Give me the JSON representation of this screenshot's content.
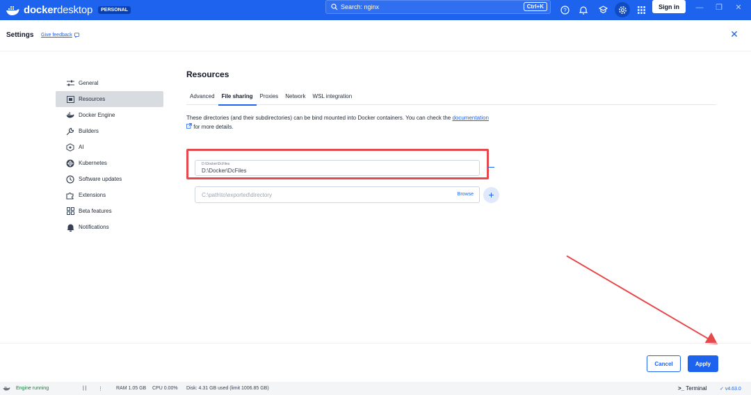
{
  "titlebar": {
    "brand_bold": "docker",
    "brand_light": "desktop",
    "plan_badge": "PERSONAL",
    "search_placeholder": "Search: nginx",
    "search_shortcut": "Ctrl+K",
    "sign_in": "Sign in",
    "icons": [
      "help-icon",
      "bell-icon",
      "learning-center-icon",
      "gear-icon",
      "grid-icon"
    ]
  },
  "header": {
    "title": "Settings",
    "feedback": "Give feedback",
    "close": "✕"
  },
  "nav": {
    "items": [
      {
        "label": "General",
        "icon": "sliders-icon"
      },
      {
        "label": "Resources",
        "icon": "resources-icon"
      },
      {
        "label": "Docker Engine",
        "icon": "whale-icon"
      },
      {
        "label": "Builders",
        "icon": "wrench-icon"
      },
      {
        "label": "AI",
        "icon": "ai-icon"
      },
      {
        "label": "Kubernetes",
        "icon": "kubernetes-icon"
      },
      {
        "label": "Software updates",
        "icon": "clock-icon"
      },
      {
        "label": "Extensions",
        "icon": "puzzle-icon"
      },
      {
        "label": "Beta features",
        "icon": "grid-icon"
      },
      {
        "label": "Notifications",
        "icon": "bell-icon"
      }
    ],
    "selected": "Resources"
  },
  "main": {
    "title": "Resources",
    "tabs": [
      "Advanced",
      "File sharing",
      "Proxies",
      "Network",
      "WSL integration"
    ],
    "active_tab": "File sharing",
    "description_before": "These directories (and their subdirectories) can be bind mounted into Docker containers. You can check the ",
    "description_link": "documentation",
    "description_after": " for more details.",
    "shared_path_label": "D:\\Docker\\DcFiles",
    "shared_path_value": "D:\\Docker\\DcFiles",
    "new_path_placeholder": "C:\\path\\to\\exported\\directory",
    "browse": "Browse"
  },
  "footer": {
    "cancel": "Cancel",
    "apply": "Apply"
  },
  "statusbar": {
    "engine": "Engine running",
    "ram": "RAM 1.05 GB",
    "cpu": "CPU 0.00%",
    "disk": "Disk: 4.31 GB used (limit 1006.85 GB)",
    "terminal": "Terminal",
    "version": "v4.63.0"
  },
  "colors": {
    "brand_blue": "#1d63ed",
    "annotation_red": "#e5484d"
  }
}
